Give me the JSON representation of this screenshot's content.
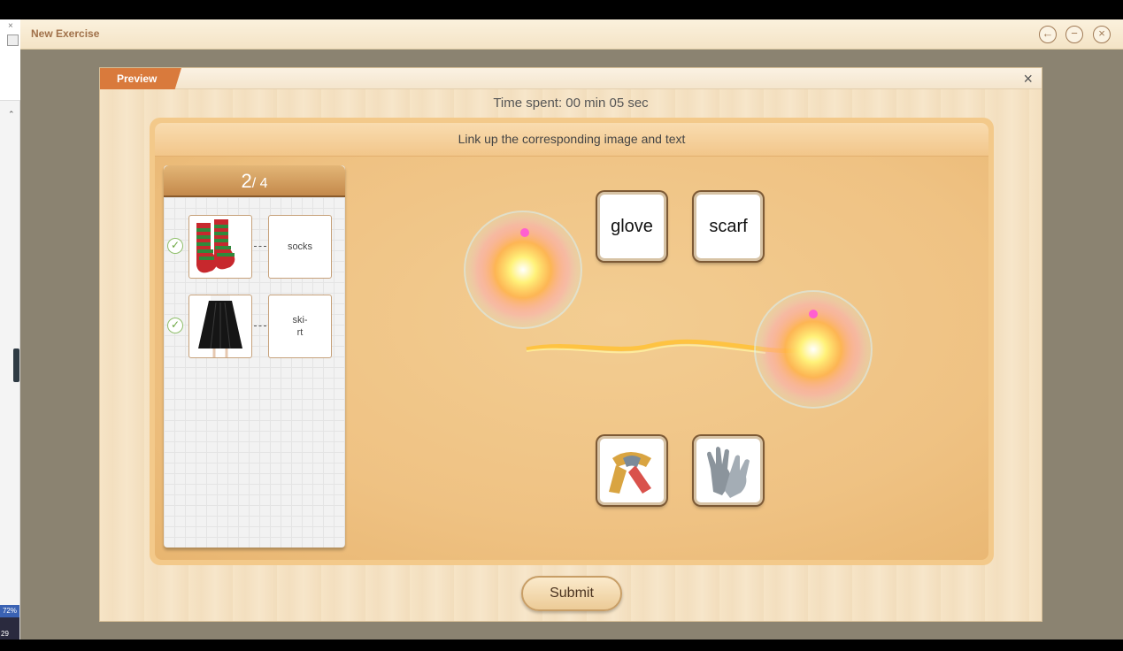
{
  "window": {
    "title": "New Exercise",
    "back_icon": "←",
    "minimize_icon": "−",
    "close_icon": "×"
  },
  "left_strip": {
    "battery": "72%",
    "clock": "29"
  },
  "dialog": {
    "tab_label": "Preview",
    "close_icon": "×",
    "time_spent": "Time spent: 00 min 05 sec",
    "instruction": "Link up the corresponding image and text",
    "submit_label": "Submit"
  },
  "progress": {
    "current": "2",
    "total": "/ 4",
    "pairs": [
      {
        "image": "socks-image",
        "word": "socks",
        "matched": true,
        "check_icon": "✓"
      },
      {
        "image": "skirt-image",
        "word": "ski-\nrt",
        "matched": true,
        "check_icon": "✓"
      }
    ]
  },
  "board": {
    "word_cards": [
      "glove",
      "scarf"
    ],
    "image_cards": [
      "scarf-image",
      "glove-image"
    ]
  },
  "colors": {
    "accent": "#d97a3c",
    "title": "#a0714a",
    "board": "#f3c98a",
    "check": "#6aa640"
  }
}
